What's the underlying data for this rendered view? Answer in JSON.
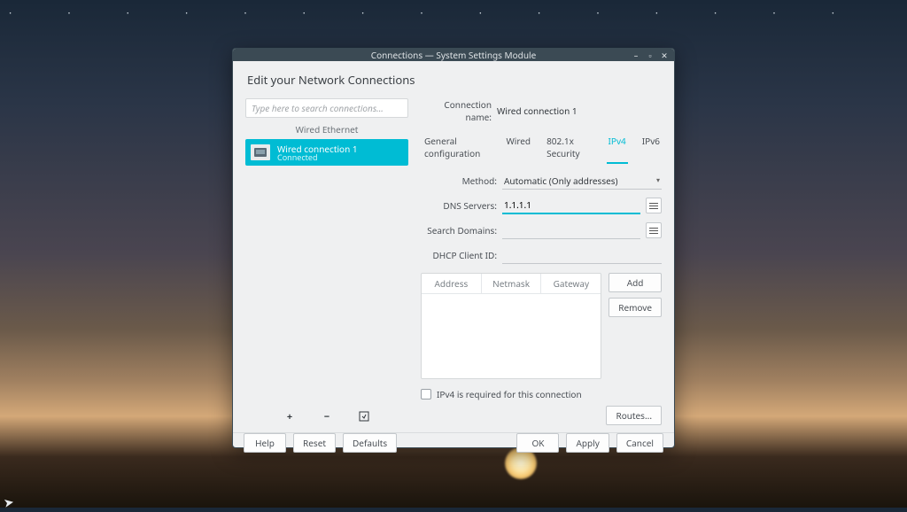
{
  "window": {
    "title": "Connections — System Settings Module",
    "heading": "Edit your Network Connections"
  },
  "sidebar": {
    "search_placeholder": "Type here to search connections...",
    "category": "Wired Ethernet",
    "items": [
      {
        "name": "Wired connection 1",
        "status": "Connected"
      }
    ]
  },
  "details": {
    "name_label": "Connection name:",
    "name_value": "Wired connection 1",
    "tabs": [
      "General configuration",
      "Wired",
      "802.1x Security",
      "IPv4",
      "IPv6"
    ],
    "active_tab_index": 3,
    "ipv4": {
      "method_label": "Method:",
      "method_value": "Automatic (Only addresses)",
      "dns_label": "DNS Servers:",
      "dns_value": "1.1.1.1",
      "search_label": "Search Domains:",
      "search_value": "",
      "dhcp_label": "DHCP Client ID:",
      "dhcp_value": "",
      "table_headers": [
        "Address",
        "Netmask",
        "Gateway"
      ],
      "add_label": "Add",
      "remove_label": "Remove",
      "required_label": "IPv4 is required for this connection",
      "required_checked": false,
      "routes_label": "Routes..."
    }
  },
  "footer": {
    "help": "Help",
    "reset": "Reset",
    "defaults": "Defaults",
    "ok": "OK",
    "apply": "Apply",
    "cancel": "Cancel"
  }
}
